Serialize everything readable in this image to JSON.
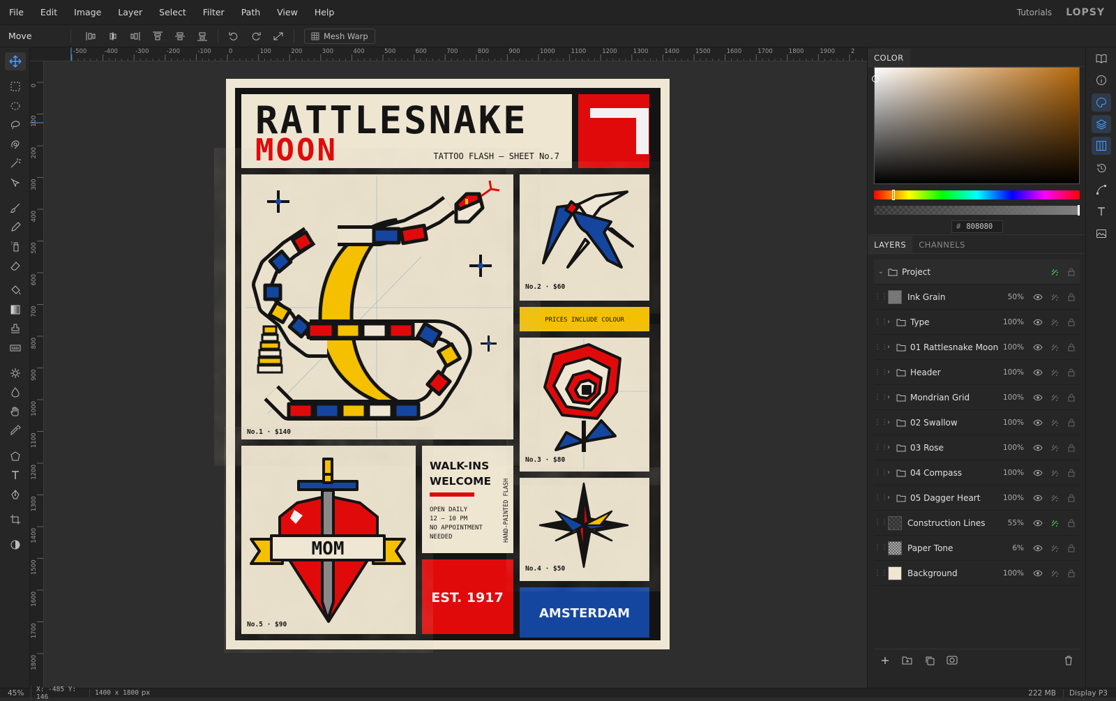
{
  "menu": {
    "items": [
      "File",
      "Edit",
      "Image",
      "Layer",
      "Select",
      "Filter",
      "Path",
      "View",
      "Help"
    ],
    "tutorials": "Tutorials",
    "logo": "LOPSY"
  },
  "options": {
    "tool_name": "Move",
    "mesh_warp": "Mesh Warp"
  },
  "ruler": {
    "top_ticks": [
      "-500",
      "-400",
      "-300",
      "-200",
      "-100",
      "0",
      "100",
      "200",
      "300",
      "400",
      "500",
      "600",
      "700",
      "800",
      "900",
      "1000",
      "1100",
      "1200",
      "1300",
      "1400",
      "1500",
      "1600",
      "1700",
      "1800",
      "1900",
      "2"
    ],
    "left_ticks": [
      "0",
      "100",
      "200",
      "300",
      "400",
      "500",
      "600",
      "700",
      "800",
      "900",
      "1000",
      "1100",
      "1200",
      "1300",
      "1400",
      "1500",
      "1600",
      "1700",
      "1800"
    ]
  },
  "poster": {
    "title_line1": "RATTLESNAKE",
    "title_line2": "MOON",
    "subtitle": "TATTOO FLASH — SHEET No.7",
    "price1": "No.1 · $140",
    "price2": "No.2 · $60",
    "price3": "No.3 · $80",
    "price4": "No.4 · $50",
    "price5": "No.5 · $90",
    "prices_banner": "PRICES INCLUDE COLOUR",
    "walkins_line1": "WALK-INS",
    "walkins_line2": "WELCOME",
    "hours_line1": "OPEN DAILY",
    "hours_line2": "12 — 10 PM",
    "hours_line3": "NO APPOINTMENT",
    "hours_line4": "NEEDED",
    "vertical": "HAND-PAINTED FLASH",
    "heart_banner": "MOM",
    "est": "EST. 1917",
    "city": "AMSTERDAM"
  },
  "color_panel": {
    "tab": "COLOR",
    "hex_prefix": "#",
    "hex": "808080"
  },
  "layers_panel": {
    "tabs": [
      "LAYERS",
      "CHANNELS"
    ],
    "project": "Project",
    "layers": [
      {
        "name": "Ink Grain",
        "opacity": "50%",
        "folder": false
      },
      {
        "name": "Type",
        "opacity": "100%",
        "folder": true
      },
      {
        "name": "01 Rattlesnake Moon",
        "opacity": "100%",
        "folder": true
      },
      {
        "name": "Header",
        "opacity": "100%",
        "folder": true
      },
      {
        "name": "Mondrian Grid",
        "opacity": "100%",
        "folder": true
      },
      {
        "name": "02 Swallow",
        "opacity": "100%",
        "folder": true
      },
      {
        "name": "03 Rose",
        "opacity": "100%",
        "folder": true
      },
      {
        "name": "04 Compass",
        "opacity": "100%",
        "folder": true
      },
      {
        "name": "05 Dagger Heart",
        "opacity": "100%",
        "folder": true
      },
      {
        "name": "Construction Lines",
        "opacity": "55%",
        "folder": false
      },
      {
        "name": "Paper Tone",
        "opacity": "6%",
        "folder": false
      },
      {
        "name": "Background",
        "opacity": "100%",
        "folder": false
      }
    ]
  },
  "status": {
    "zoom": "45%",
    "coords": "X: -485 Y: 146",
    "size": "1400 x 1800",
    "size_unit": "px",
    "memory": "222 MB",
    "profile": "Display P3"
  },
  "colors": {
    "red": "#e10a0a",
    "blue": "#1446a0",
    "yellow": "#f5c000",
    "ink": "#141414",
    "paper": "#efe7d4",
    "accent": "#4a9eff"
  }
}
